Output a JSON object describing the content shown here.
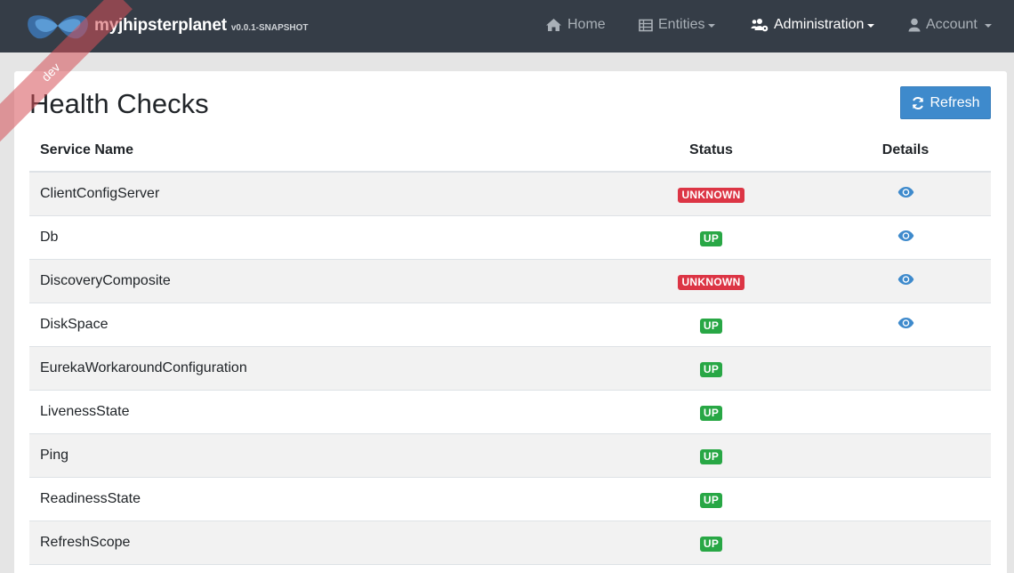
{
  "navbar": {
    "brand_name": "myjhipsterplanet",
    "version": "v0.0.1-SNAPSHOT",
    "ribbon": "dev",
    "items": [
      {
        "label": "Home",
        "icon": "home-icon"
      },
      {
        "label": "Entities",
        "icon": "table-icon"
      },
      {
        "label": "Administration",
        "icon": "users-cog-icon"
      },
      {
        "label": "Account",
        "icon": "user-icon"
      }
    ]
  },
  "page": {
    "title": "Health Checks",
    "refresh_label": "Refresh"
  },
  "table": {
    "headers": {
      "name": "Service Name",
      "status": "Status",
      "details": "Details"
    },
    "rows": [
      {
        "name": "ClientConfigServer",
        "status": "UNKNOWN",
        "has_details": true
      },
      {
        "name": "Db",
        "status": "UP",
        "has_details": true
      },
      {
        "name": "DiscoveryComposite",
        "status": "UNKNOWN",
        "has_details": true
      },
      {
        "name": "DiskSpace",
        "status": "UP",
        "has_details": true
      },
      {
        "name": "EurekaWorkaroundConfiguration",
        "status": "UP",
        "has_details": false
      },
      {
        "name": "LivenessState",
        "status": "UP",
        "has_details": false
      },
      {
        "name": "Ping",
        "status": "UP",
        "has_details": false
      },
      {
        "name": "ReadinessState",
        "status": "UP",
        "has_details": false
      },
      {
        "name": "RefreshScope",
        "status": "UP",
        "has_details": false
      }
    ]
  },
  "colors": {
    "navbar": "#353d47",
    "primary": "#3e8acc",
    "up": "#28a745",
    "unknown": "#dc3545"
  }
}
